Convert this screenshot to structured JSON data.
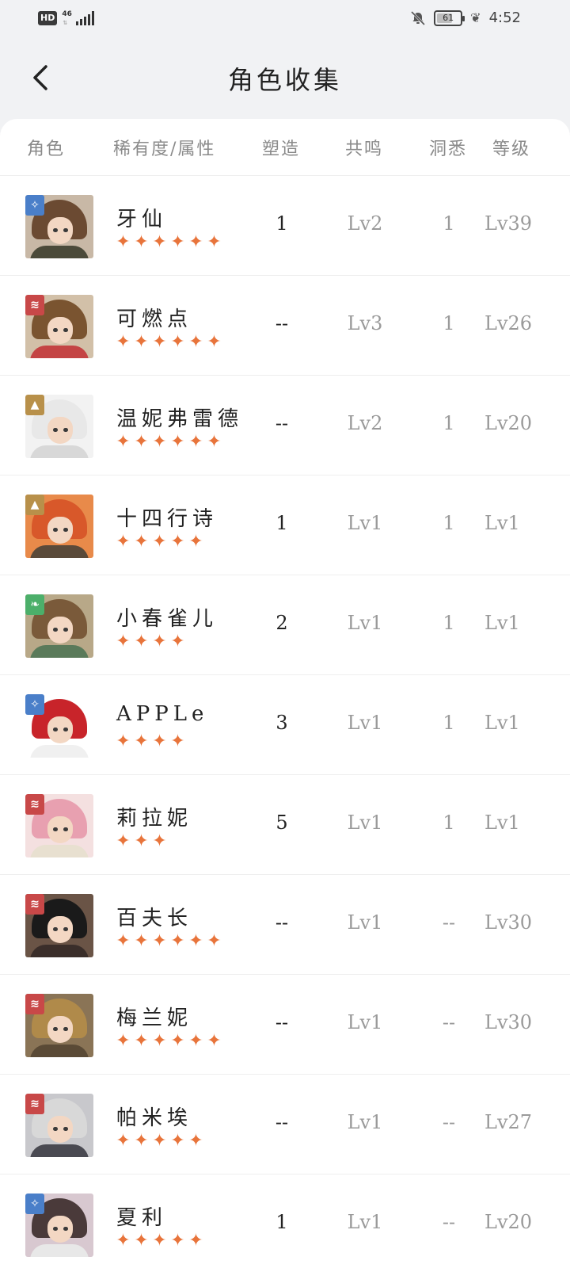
{
  "status": {
    "hd": "HD",
    "net": "46",
    "battery": "61",
    "time": "4:52"
  },
  "header": {
    "title": "角色收集"
  },
  "columns": {
    "character": "角色",
    "rarity": "稀有度/属性",
    "molding": "塑造",
    "resonance": "共鸣",
    "insight": "洞悉",
    "level": "等级"
  },
  "rows": [
    {
      "name": "牙仙",
      "stars": "★★★★★★",
      "rarity": 6,
      "molding": "1",
      "resonance": "Lv2",
      "insight": "1",
      "level": "Lv39",
      "attr_icon": "wave-icon",
      "attr_color": "#4a7fc9",
      "hair": "#6b4a32",
      "body": "#4b4a3a",
      "bg": "#c8b8a6"
    },
    {
      "name": "可燃点",
      "stars": "★★★★★★",
      "rarity": 6,
      "molding": "--",
      "resonance": "Lv3",
      "insight": "1",
      "level": "Lv26",
      "attr_icon": "beast-icon",
      "attr_color": "#c84848",
      "hair": "#7a5430",
      "body": "#c44444",
      "bg": "#d2c0a8"
    },
    {
      "name": "温妮弗雷德",
      "stars": "★★★★★★",
      "rarity": 6,
      "molding": "--",
      "resonance": "Lv2",
      "insight": "1",
      "level": "Lv20",
      "attr_icon": "rock-icon",
      "attr_color": "#b8904a",
      "hair": "#e8e8e8",
      "body": "#d8d8d8",
      "bg": "#f2f2f2"
    },
    {
      "name": "十四行诗",
      "stars": "★★★★★",
      "rarity": 5,
      "molding": "1",
      "resonance": "Lv1",
      "insight": "1",
      "level": "Lv1",
      "attr_icon": "rock-icon",
      "attr_color": "#b8904a",
      "hair": "#d8582a",
      "body": "#5a4a3a",
      "bg": "#e88a4a"
    },
    {
      "name": "小春雀儿",
      "stars": "★★★★",
      "rarity": 4,
      "molding": "2",
      "resonance": "Lv1",
      "insight": "1",
      "level": "Lv1",
      "attr_icon": "leaf-icon",
      "attr_color": "#4caf6a",
      "hair": "#7a5a3a",
      "body": "#5a7a5a",
      "bg": "#b8a888"
    },
    {
      "name": "APPLe",
      "stars": "★★★★",
      "rarity": 4,
      "molding": "3",
      "resonance": "Lv1",
      "insight": "1",
      "level": "Lv1",
      "attr_icon": "wave-icon",
      "attr_color": "#4a7fc9",
      "hair": "#c8242a",
      "body": "#f0f0f0",
      "bg": "#ffffff"
    },
    {
      "name": "莉拉妮",
      "stars": "★★★",
      "rarity": 3,
      "molding": "5",
      "resonance": "Lv1",
      "insight": "1",
      "level": "Lv1",
      "attr_icon": "beast-icon",
      "attr_color": "#c84848",
      "hair": "#e8a0b0",
      "body": "#e8e0d0",
      "bg": "#f4e0e0"
    },
    {
      "name": "百夫长",
      "stars": "★★★★★★",
      "rarity": 6,
      "molding": "--",
      "resonance": "Lv1",
      "insight": "--",
      "level": "Lv30",
      "attr_icon": "beast-icon",
      "attr_color": "#c84848",
      "hair": "#1a1a1a",
      "body": "#3a2e2a",
      "bg": "#6a5446"
    },
    {
      "name": "梅兰妮",
      "stars": "★★★★★★",
      "rarity": 6,
      "molding": "--",
      "resonance": "Lv1",
      "insight": "--",
      "level": "Lv30",
      "attr_icon": "beast-icon",
      "attr_color": "#c84848",
      "hair": "#b08a4a",
      "body": "#5a4a36",
      "bg": "#8a7456"
    },
    {
      "name": "帕米埃",
      "stars": "★★★★★",
      "rarity": 5,
      "molding": "--",
      "resonance": "Lv1",
      "insight": "--",
      "level": "Lv27",
      "attr_icon": "beast-icon",
      "attr_color": "#c84848",
      "hair": "#d8d8d8",
      "body": "#4a4a52",
      "bg": "#c8c8cc"
    },
    {
      "name": "夏利",
      "stars": "★★★★★",
      "rarity": 5,
      "molding": "1",
      "resonance": "Lv1",
      "insight": "--",
      "level": "Lv20",
      "attr_icon": "wave-icon",
      "attr_color": "#4a7fc9",
      "hair": "#4a3a3a",
      "body": "#e8e8e8",
      "bg": "#d8c8d0"
    }
  ]
}
